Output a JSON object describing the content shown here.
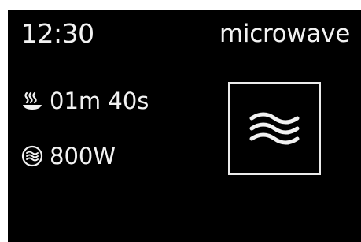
{
  "status": {
    "clock": "12:30",
    "mode_name": "microwave"
  },
  "settings": {
    "cook_time": "01m 40s",
    "power": "800W"
  },
  "icons": {
    "cook_time": "steaming-dish-icon",
    "power": "microwave-waves-circle-icon",
    "mode": "microwave-waves-icon"
  },
  "colors": {
    "background": "#000000",
    "foreground": "#f2f2f2"
  }
}
